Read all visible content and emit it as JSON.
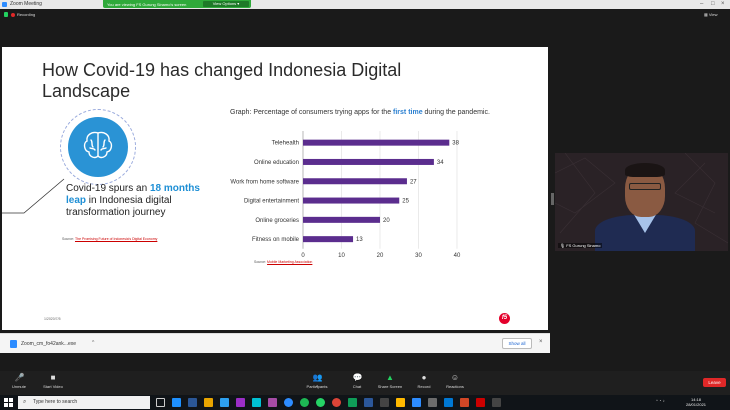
{
  "titlebar": {
    "title": "Zoom Meeting"
  },
  "sharebar": {
    "message": "You are viewing FS Gurung Sinamo's screen",
    "view_options": "View Options ▾"
  },
  "status": {
    "recording": "Recording",
    "view": "View"
  },
  "slide": {
    "title": "How Covid-19 has changed Indonesia Digital Landscape",
    "left_text_pre": "Covid-19 spurs an ",
    "left_text_hl": "18 months leap",
    "left_text_post": " in Indonesia digital transformation journey",
    "source_left_label": "Source: ",
    "source_left_link": "The Promising Future of Indonesia's Digital Economy",
    "graph_caption_pre": "Graph: Percentage of consumers trying apps for the ",
    "graph_caption_hl": "first time",
    "graph_caption_post": " during the pandemic.",
    "source_chart_label": "Source: ",
    "source_chart_link": "Mobile Marketing Association",
    "date": "1/2020/7/5",
    "logo_text": "f5"
  },
  "chart_data": {
    "type": "bar",
    "orientation": "horizontal",
    "categories": [
      "Telehealth",
      "Online education",
      "Work from home software",
      "Digital entertainment",
      "Online groceries",
      "Fitness on mobile"
    ],
    "values": [
      38,
      34,
      27,
      25,
      20,
      13
    ],
    "xlim": [
      0,
      40
    ],
    "xticks": [
      0,
      10,
      20,
      30,
      40
    ],
    "bar_color": "#5b2d8e",
    "title": "",
    "xlabel": "",
    "ylabel": ""
  },
  "video": {
    "name": "FS Gurung Sinamo"
  },
  "download": {
    "filename": "Zoom_cm_fo42ank...exe",
    "chevron": "^",
    "show_all": "Show all",
    "close": "×"
  },
  "toolbar": {
    "items": [
      {
        "label": "Unmute",
        "icon": "🎤"
      },
      {
        "label": "Start Video",
        "icon": "■"
      },
      {
        "label": "Participants",
        "icon": "👥"
      },
      {
        "label": "Chat",
        "icon": "💬"
      },
      {
        "label": "Share Screen",
        "icon": "▲"
      },
      {
        "label": "Record",
        "icon": "●"
      },
      {
        "label": "Reactions",
        "icon": "☺"
      }
    ],
    "participants_count": "2",
    "leave": "Leave"
  },
  "taskbar": {
    "search_placeholder": "Type here to search",
    "time": "14:18",
    "date": "28/01/2021"
  }
}
